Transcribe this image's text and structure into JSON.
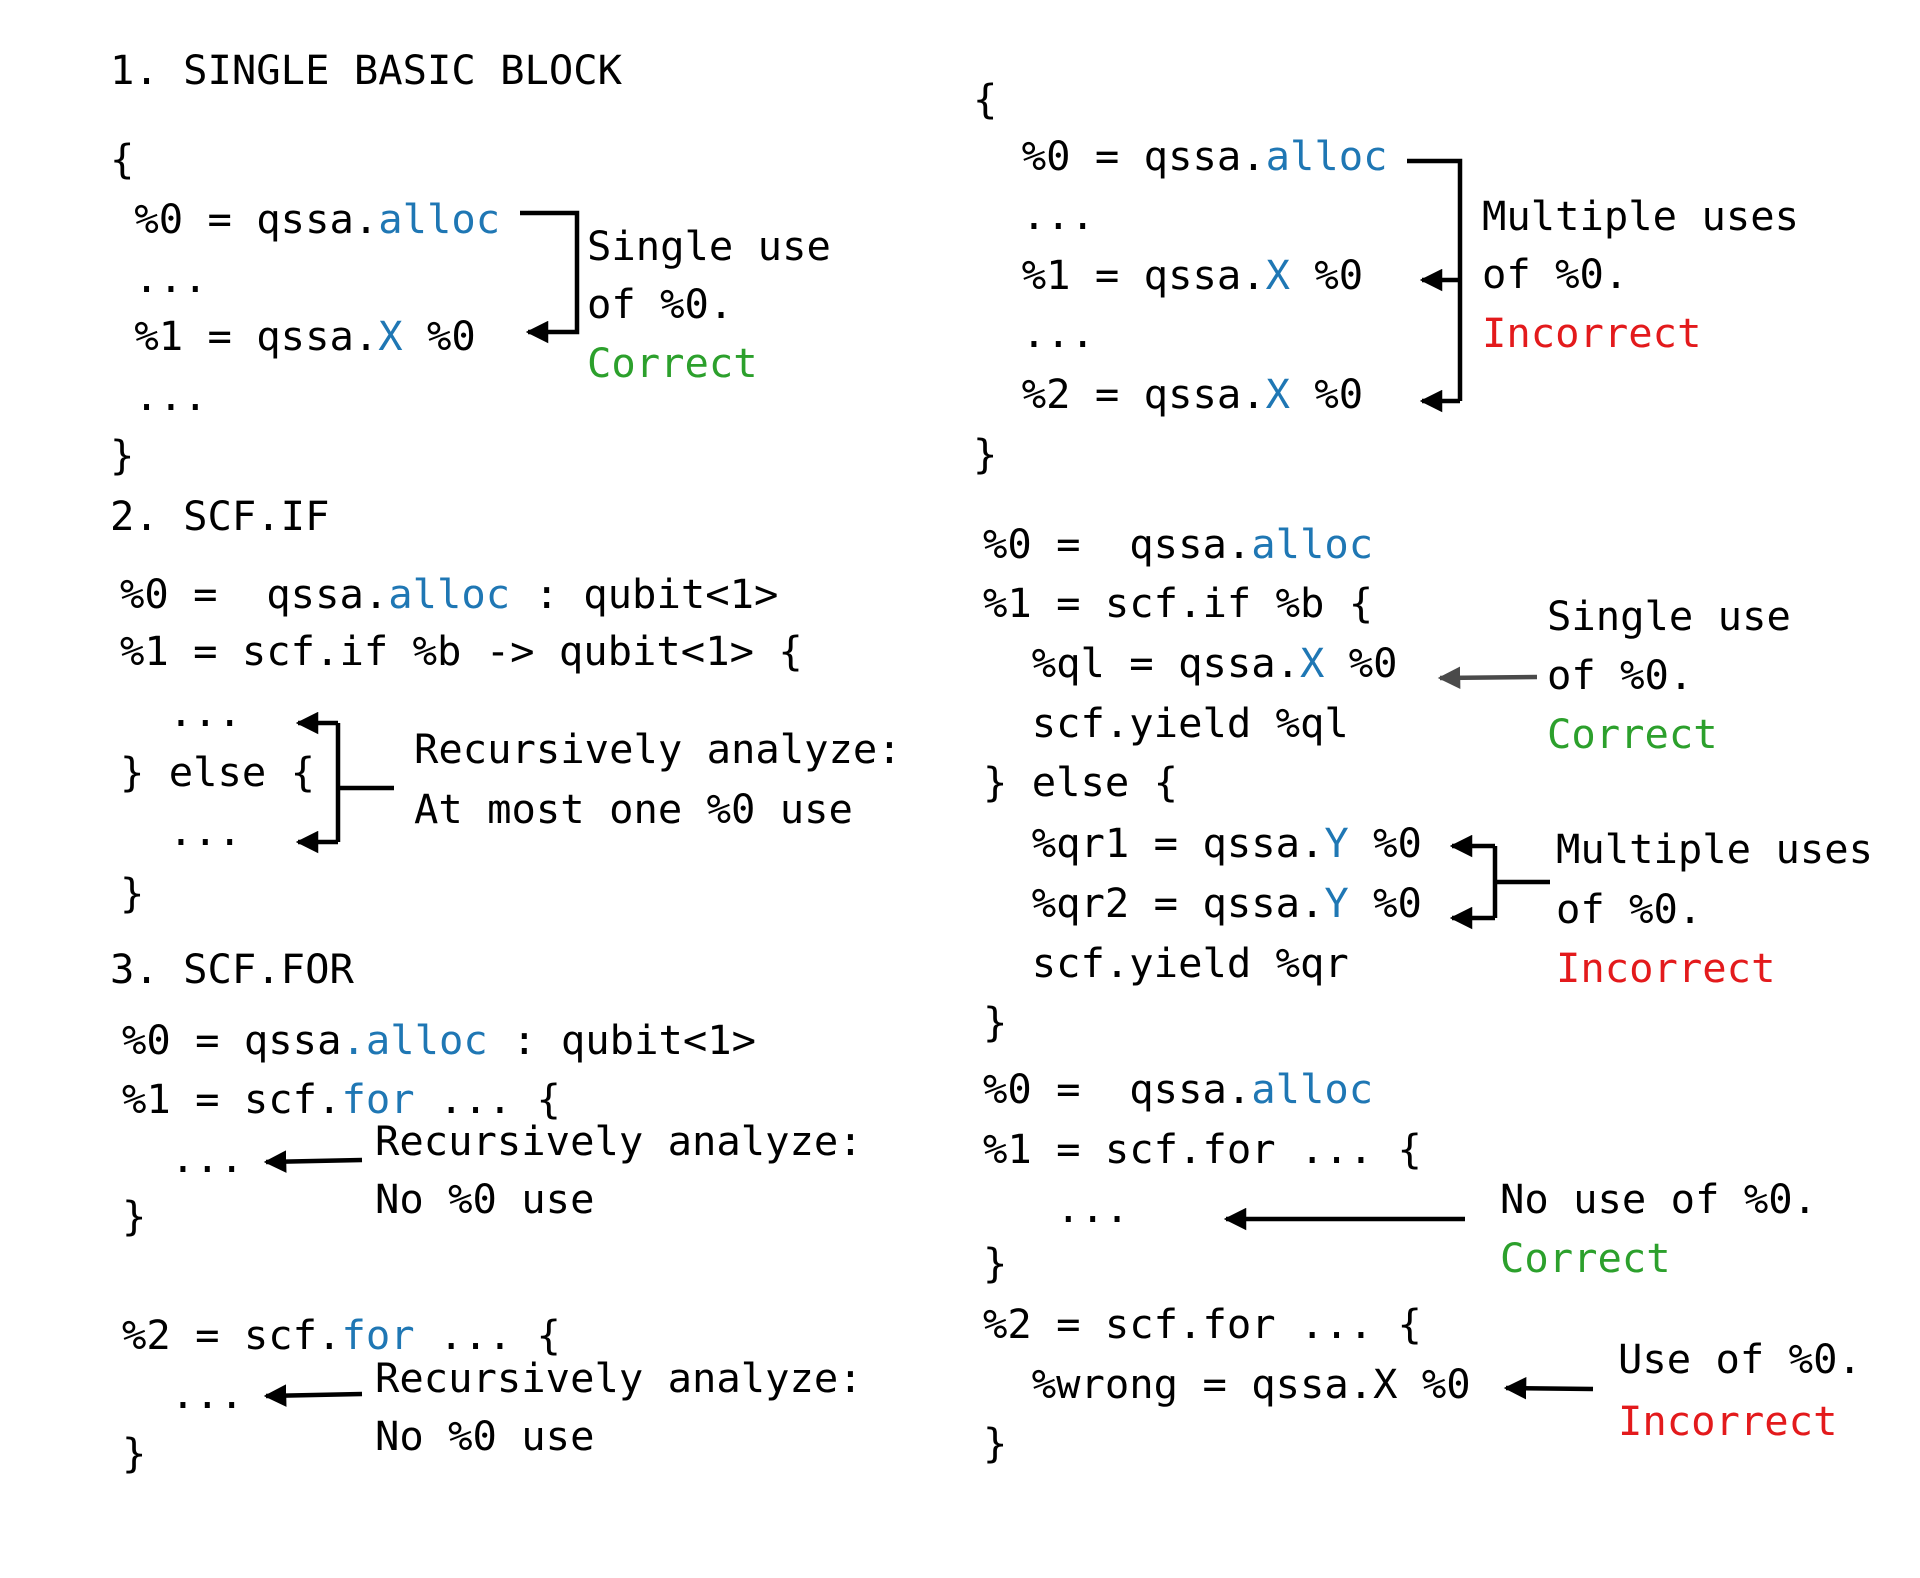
{
  "colors": {
    "text": "#000000",
    "keyword": "#1f77b4",
    "correct": "#2ca02c",
    "incorrect": "#e31a1c",
    "arrow": "#000000",
    "arrow_grey": "#4a4a4a"
  },
  "sections": [
    {
      "id": "single-basic-block",
      "heading": "1. SINGLE BASIC BLOCK",
      "correct_example": {
        "lines": [
          [
            {
              "t": "{"
            }
          ],
          [
            {
              "t": " %0 = qssa."
            },
            {
              "t": "alloc",
              "c": "kw"
            }
          ],
          [
            {
              "t": " ..."
            }
          ],
          [
            {
              "t": " %1 = qssa."
            },
            {
              "t": "X",
              "c": "kw"
            },
            {
              "t": " %0"
            }
          ],
          [
            {
              "t": " ..."
            }
          ],
          [
            {
              "t": "}"
            }
          ]
        ],
        "annotation": [
          {
            "t": "Single use"
          },
          {
            "t": "of %0."
          },
          {
            "t": "Correct",
            "c": "ok"
          }
        ]
      },
      "incorrect_example": {
        "lines": [
          [
            {
              "t": "{"
            }
          ],
          [
            {
              "t": "  %0 = qssa."
            },
            {
              "t": "alloc",
              "c": "kw"
            }
          ],
          [
            {
              "t": "  ..."
            }
          ],
          [
            {
              "t": "  %1 = qssa."
            },
            {
              "t": "X",
              "c": "kw"
            },
            {
              "t": " %0"
            }
          ],
          [
            {
              "t": "  ..."
            }
          ],
          [
            {
              "t": "  %2 = qssa."
            },
            {
              "t": "X",
              "c": "kw"
            },
            {
              "t": " %0"
            }
          ],
          [
            {
              "t": "}"
            }
          ]
        ],
        "annotation": [
          {
            "t": "Multiple uses"
          },
          {
            "t": "of %0."
          },
          {
            "t": "Incorrect",
            "c": "bad"
          }
        ]
      }
    },
    {
      "id": "scf-if",
      "heading": "2. SCF.IF",
      "rule_example": {
        "lines": [
          [
            {
              "t": "%0 =  qssa."
            },
            {
              "t": "alloc",
              "c": "kw"
            },
            {
              "t": " : qubit<1>"
            }
          ],
          [
            {
              "t": "%1 = scf.if %b -> qubit<1> {"
            }
          ],
          [
            {
              "t": "  ..."
            }
          ],
          [
            {
              "t": "} else {"
            }
          ],
          [
            {
              "t": "  ..."
            }
          ],
          [
            {
              "t": "}"
            }
          ]
        ],
        "annotation": [
          {
            "t": "Recursively analyze:"
          },
          {
            "t": "At most one %0 use"
          }
        ]
      },
      "examples": [
        {
          "lines": [
            [
              {
                "t": "%0 =  qssa."
              },
              {
                "t": "alloc",
                "c": "kw"
              }
            ],
            [
              {
                "t": "%1 = scf.if %b {"
              }
            ],
            [
              {
                "t": "  %ql = qssa."
              },
              {
                "t": "X",
                "c": "kw"
              },
              {
                "t": " %0"
              }
            ],
            [
              {
                "t": "  scf.yield %ql"
              }
            ],
            [
              {
                "t": "} else {"
              }
            ],
            [
              {
                "t": "  %qr1 = qssa."
              },
              {
                "t": "Y",
                "c": "kw"
              },
              {
                "t": " %0"
              }
            ],
            [
              {
                "t": "  %qr2 = qssa."
              },
              {
                "t": "Y",
                "c": "kw"
              },
              {
                "t": " %0"
              }
            ],
            [
              {
                "t": "  scf.yield %qr"
              }
            ],
            [
              {
                "t": "}"
              }
            ]
          ],
          "annotations": [
            [
              {
                "t": "Single use"
              },
              {
                "t": "of %0."
              },
              {
                "t": "Correct",
                "c": "ok"
              }
            ],
            [
              {
                "t": "Multiple uses"
              },
              {
                "t": "of %0."
              },
              {
                "t": "Incorrect",
                "c": "bad"
              }
            ]
          ]
        }
      ]
    },
    {
      "id": "scf-for",
      "heading": "3. SCF.FOR",
      "rule_example": {
        "lines": [
          [
            {
              "t": "%0 = qssa"
            },
            {
              "t": ".alloc",
              "c": "kw"
            },
            {
              "t": " : qubit<1>"
            }
          ],
          [
            {
              "t": "%1 = scf."
            },
            {
              "t": "for",
              "c": "kw"
            },
            {
              "t": " ... {"
            }
          ],
          [
            {
              "t": "  ..."
            }
          ],
          [
            {
              "t": "}"
            }
          ],
          [
            {
              "t": "%2 = scf."
            },
            {
              "t": "for",
              "c": "kw"
            },
            {
              "t": " ... {"
            }
          ],
          [
            {
              "t": "  ..."
            }
          ],
          [
            {
              "t": "}"
            }
          ]
        ],
        "annotations": [
          [
            {
              "t": "Recursively analyze:"
            },
            {
              "t": "No %0 use"
            }
          ],
          [
            {
              "t": "Recursively analyze:"
            },
            {
              "t": "No %0 use"
            }
          ]
        ]
      },
      "examples": [
        {
          "lines": [
            [
              {
                "t": "%0 =  qssa."
              },
              {
                "t": "alloc",
                "c": "kw"
              }
            ],
            [
              {
                "t": "%1 = scf.for ... {"
              }
            ],
            [
              {
                "t": "   ..."
              }
            ],
            [
              {
                "t": "}"
              }
            ],
            [
              {
                "t": "%2 = scf.for ... {"
              }
            ],
            [
              {
                "t": "  %wrong = qssa.X %0"
              }
            ],
            [
              {
                "t": "}"
              }
            ]
          ],
          "annotations": [
            [
              {
                "t": "No use of %0."
              },
              {
                "t": "Correct",
                "c": "ok"
              }
            ],
            [
              {
                "t": "Use of %0."
              },
              {
                "t": "Incorrect",
                "c": "bad"
              }
            ]
          ]
        }
      ]
    }
  ]
}
